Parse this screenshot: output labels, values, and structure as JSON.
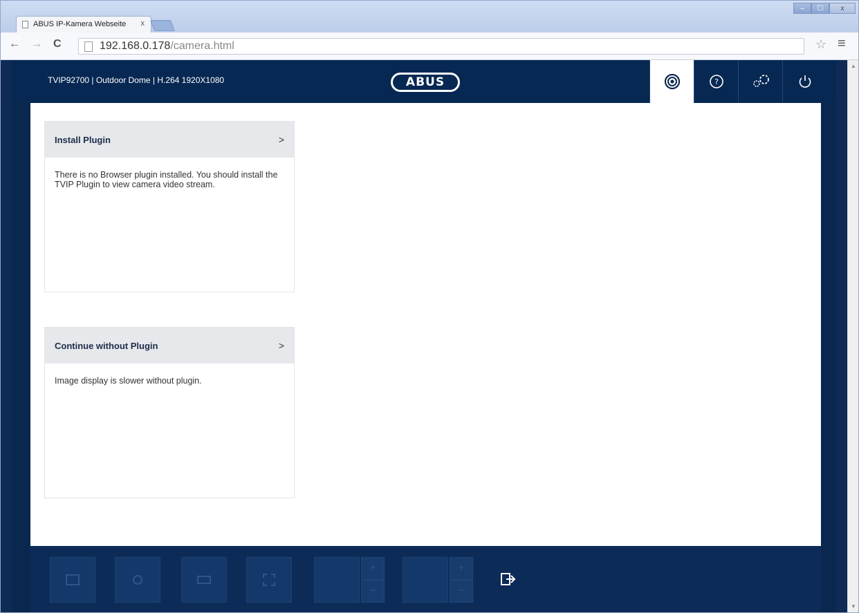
{
  "browser": {
    "tab_title": "ABUS IP-Kamera Webseite",
    "tab_close": "x",
    "url_host": "192.168.0.178",
    "url_path": "/camera.html",
    "window_buttons": [
      "–",
      "☐",
      "x"
    ]
  },
  "header": {
    "model": "TVIP92700 | Outdoor Dome | H.264 1920X1080",
    "logo": "ABUS",
    "nav_icons": [
      "live-view-icon",
      "help-icon",
      "settings-icon",
      "power-icon"
    ]
  },
  "cards": [
    {
      "title": "Install Plugin",
      "chevron": ">",
      "body": "There is no Browser plugin installed. You should install the TVIP Plugin to view camera video stream."
    },
    {
      "title": "Continue without Plugin",
      "chevron": ">",
      "body": "Image display is slower without plugin."
    }
  ],
  "footer": {
    "stepper_plus": "+",
    "stepper_minus": "−",
    "exit_icon": "exit-icon"
  },
  "colors": {
    "header_bg": "#072853",
    "footer_bg": "#0d2b57",
    "card_head_bg": "#e6e8ec"
  }
}
